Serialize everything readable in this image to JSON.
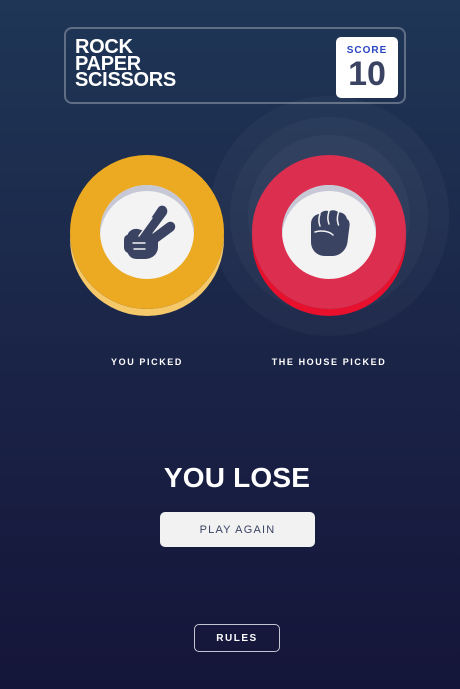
{
  "header": {
    "title_lines": [
      "ROCK",
      "PAPER",
      "SCISSORS"
    ],
    "score_label": "SCORE",
    "score_value": "10"
  },
  "player": {
    "label": "YOU PICKED",
    "choice": "scissors",
    "icon": "scissors-hand-icon",
    "color": "#eca922"
  },
  "house": {
    "label": "THE HOUSE PICKED",
    "choice": "rock",
    "icon": "rock-fist-icon",
    "color": "#dc2e4e"
  },
  "result": {
    "text": "YOU LOSE",
    "play_again_label": "PLAY AGAIN"
  },
  "footer": {
    "rules_label": "RULES"
  },
  "colors": {
    "background_top": "#1f3656",
    "background_bottom": "#141539",
    "icon": "#3b4363"
  }
}
